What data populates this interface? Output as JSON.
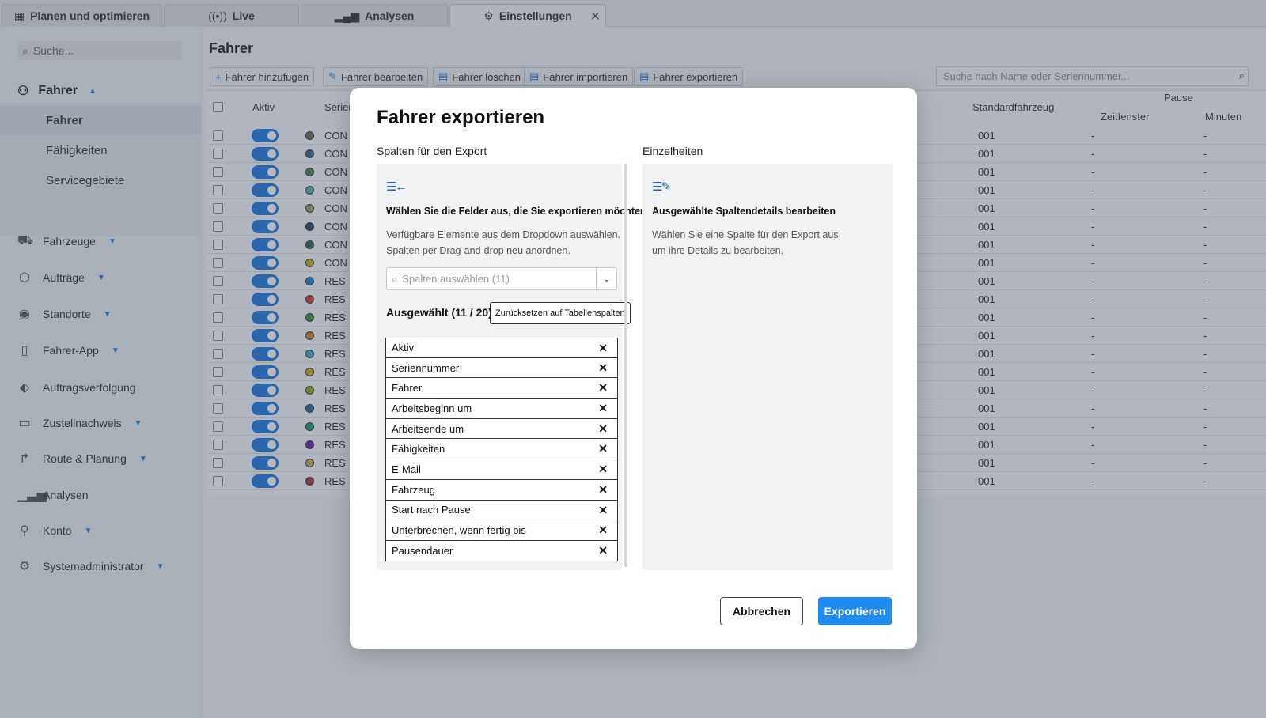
{
  "tabs": [
    {
      "label": "Planen und optimieren",
      "icon": "calendar-icon"
    },
    {
      "label": "Live",
      "icon": "broadcast-icon"
    },
    {
      "label": "Analysen",
      "icon": "bar-chart-icon"
    },
    {
      "label": "Einstellungen",
      "icon": "gear-icon"
    }
  ],
  "sidebar": {
    "search_placeholder": "Suche...",
    "section": "Fahrer",
    "subitems": [
      "Fahrer",
      "Fähigkeiten",
      "Servicegebiete"
    ],
    "items": [
      {
        "label": "Fahrzeuge",
        "icon": "truck-icon"
      },
      {
        "label": "Aufträge",
        "icon": "box-icon"
      },
      {
        "label": "Standorte",
        "icon": "location-pin-icon"
      },
      {
        "label": "Fahrer-App",
        "icon": "phone-icon"
      },
      {
        "label": "Auftragsverfolgung",
        "icon": "tag-icon"
      },
      {
        "label": "Zustellnachweis",
        "icon": "clipboard-icon"
      },
      {
        "label": "Route & Planung",
        "icon": "route-arrow-icon"
      },
      {
        "label": "Analysen",
        "icon": "bar-chart-icon"
      },
      {
        "label": "Konto",
        "icon": "user-icon"
      },
      {
        "label": "Systemadministrator",
        "icon": "gear-icon"
      }
    ]
  },
  "main": {
    "title": "Fahrer",
    "toolbar": [
      "Fahrer hinzufügen",
      "Fahrer bearbeiten",
      "Fahrer löschen",
      "Fahrer importieren",
      "Fahrer exportieren"
    ],
    "search_placeholder": "Suche nach Name oder Seriennummer...",
    "columns": {
      "aktiv": "Aktiv",
      "serial": "Serien",
      "vehicle": "Standardfahrzeug",
      "pause": "Pause",
      "window": "Zeitfenster",
      "minutes": "Minuten"
    },
    "rows": [
      {
        "serial": "CON",
        "dot": "#7a6a55",
        "vehicle": "001",
        "window": "-",
        "minutes": "-"
      },
      {
        "serial": "CON",
        "dot": "#3a6a8a",
        "vehicle": "001",
        "window": "-",
        "minutes": "-"
      },
      {
        "serial": "CON",
        "dot": "#4a8a4a",
        "vehicle": "001",
        "window": "-",
        "minutes": "-"
      },
      {
        "serial": "CON",
        "dot": "#5aaab0",
        "vehicle": "001",
        "window": "-",
        "minutes": "-"
      },
      {
        "serial": "CON",
        "dot": "#9aaa6a",
        "vehicle": "001",
        "window": "-",
        "minutes": "-"
      },
      {
        "serial": "CON",
        "dot": "#2a4a6a",
        "vehicle": "001",
        "window": "-",
        "minutes": "-"
      },
      {
        "serial": "CON",
        "dot": "#2a6a5a",
        "vehicle": "001",
        "window": "-",
        "minutes": "-"
      },
      {
        "serial": "CON",
        "dot": "#c8b020",
        "vehicle": "001",
        "window": "-",
        "minutes": "-"
      },
      {
        "serial": "RES",
        "dot": "#1a88cc",
        "vehicle": "001",
        "window": "-",
        "minutes": "-"
      },
      {
        "serial": "RES",
        "dot": "#d04a2a",
        "vehicle": "001",
        "window": "-",
        "minutes": "-"
      },
      {
        "serial": "RES",
        "dot": "#3a9a3a",
        "vehicle": "001",
        "window": "-",
        "minutes": "-"
      },
      {
        "serial": "RES",
        "dot": "#d08a2a",
        "vehicle": "001",
        "window": "-",
        "minutes": "-"
      },
      {
        "serial": "RES",
        "dot": "#3ab0c0",
        "vehicle": "001",
        "window": "-",
        "minutes": "-"
      },
      {
        "serial": "RES",
        "dot": "#d0b020",
        "vehicle": "001",
        "window": "-",
        "minutes": "-"
      },
      {
        "serial": "RES",
        "dot": "#8ab020",
        "vehicle": "001",
        "window": "-",
        "minutes": "-"
      },
      {
        "serial": "RES",
        "dot": "#2a6aa0",
        "vehicle": "001",
        "window": "-",
        "minutes": "-"
      },
      {
        "serial": "RES",
        "dot": "#20a06a",
        "vehicle": "001",
        "window": "-",
        "minutes": "-"
      },
      {
        "serial": "RES",
        "dot": "#6a20c0",
        "vehicle": "001",
        "window": "-",
        "minutes": "-"
      },
      {
        "serial": "RES",
        "dot": "#c0b060",
        "vehicle": "001",
        "window": "-",
        "minutes": "-"
      },
      {
        "serial": "RES",
        "dot": "#b03030",
        "vehicle": "001",
        "window": "-",
        "minutes": "-"
      }
    ]
  },
  "modal": {
    "title": "Fahrer exportieren",
    "left_label": "Spalten für den Export",
    "right_label": "Einzelheiten",
    "left_heading": "Wählen Sie die Felder aus, die Sie exportieren möchten",
    "left_desc_1": "Verfügbare Elemente aus dem Dropdown auswählen.",
    "left_desc_2": "Spalten per Drag-and-drop neu anordnen.",
    "select_placeholder": "Spalten auswählen (11)",
    "selected_label": "Ausgewählt (11 / 20)",
    "reset_label": "Zurücksetzen auf Tabellenspalten",
    "selected": [
      "Aktiv",
      "Seriennummer",
      "Fahrer",
      "Arbeitsbeginn um",
      "Arbeitsende um",
      "Fähigkeiten",
      "E-Mail",
      "Fahrzeug",
      "Start nach Pause",
      "Unterbrechen, wenn fertig bis",
      "Pausendauer"
    ],
    "right_heading": "Ausgewählte Spaltendetails bearbeiten",
    "right_desc_1": "Wählen Sie eine Spalte für den Export aus,",
    "right_desc_2": "um ihre Details zu bearbeiten.",
    "cancel_label": "Abbrechen",
    "export_label": "Exportieren"
  },
  "colors": {
    "accent": "#1f7ae0",
    "export_button": "#1f8cf2"
  }
}
